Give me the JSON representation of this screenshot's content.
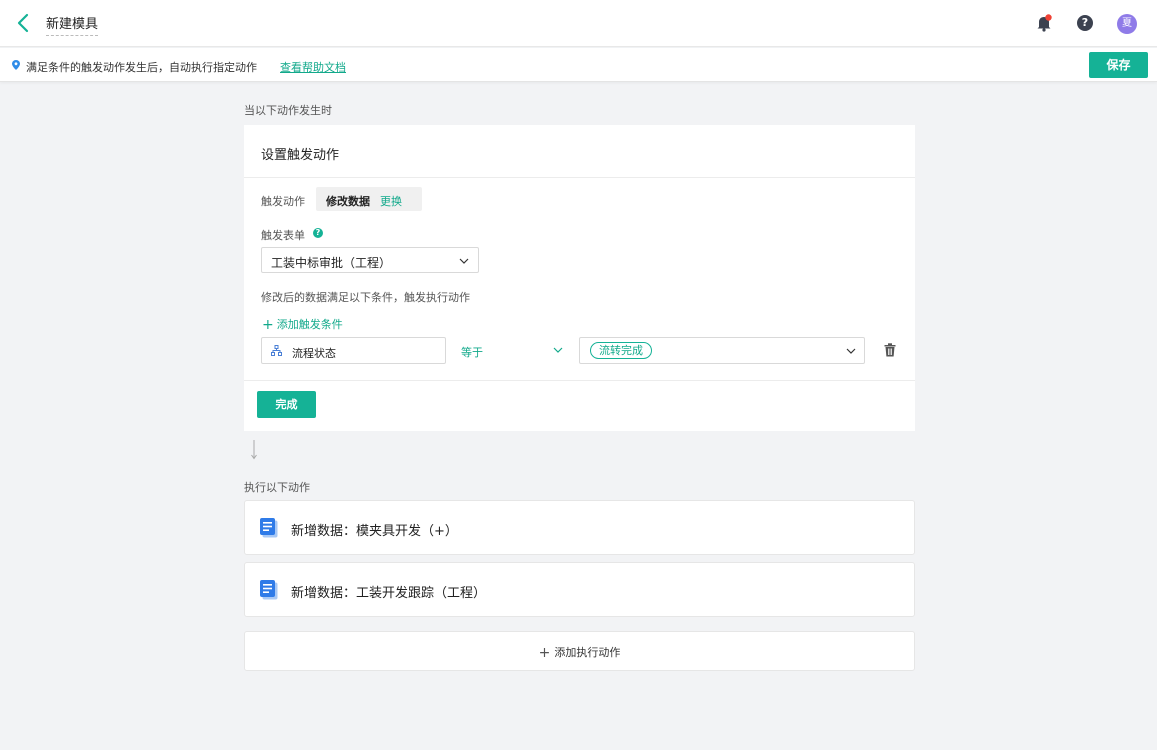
{
  "header": {
    "title": "新建模具",
    "avatar_text": "夏"
  },
  "info_bar": {
    "text": "满足条件的触发动作发生后，自动执行指定动作",
    "link": "查看帮助文档",
    "save_label": "保存"
  },
  "trigger_section": {
    "label": "当以下动作发生时",
    "card_title": "设置触发动作",
    "trigger_action_label": "触发动作",
    "trigger_action_value": "修改数据",
    "change_label": "更换",
    "trigger_form_label": "触发表单",
    "trigger_form_value": "工装中标审批（工程）",
    "condition_hint": "修改后的数据满足以下条件，触发执行动作",
    "add_condition_label": "添加触发条件",
    "condition": {
      "field": "流程状态",
      "operator": "等于",
      "value": "流转完成"
    },
    "done_label": "完成"
  },
  "exec_section": {
    "label": "执行以下动作",
    "actions": [
      {
        "text": "新增数据：模夹具开发（+）"
      },
      {
        "text": "新增数据：工装开发跟踪（工程）"
      }
    ],
    "add_action_label": "添加执行动作"
  },
  "colors": {
    "accent": "#15b296",
    "link": "#12a98b",
    "background": "#f2f3f5",
    "doc_icon": "#2f7be8",
    "notification": "#f04134",
    "avatar": "#8f7be8"
  },
  "icons": {
    "back": "chevron-left-icon",
    "notify": "bell-icon",
    "help": "question-icon",
    "info": "pin-icon",
    "field": "hierarchy-icon",
    "delete": "trash-icon",
    "action": "document-icon"
  }
}
